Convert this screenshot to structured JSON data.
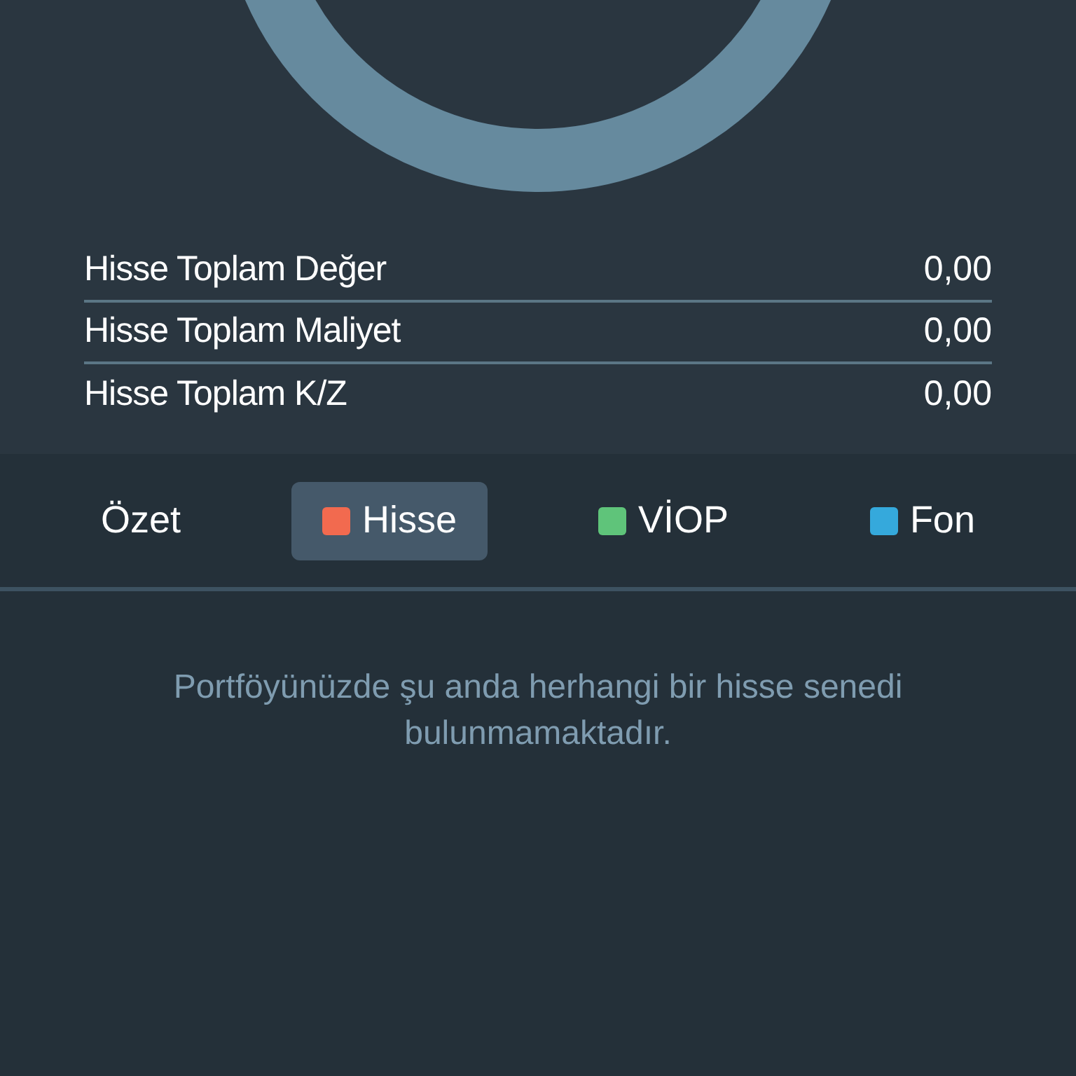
{
  "summary_rows": [
    {
      "label": "Hisse Toplam Değer",
      "value": "0,00"
    },
    {
      "label": "Hisse Toplam Maliyet",
      "value": "0,00"
    },
    {
      "label": "Hisse Toplam K/Z",
      "value": "0,00"
    }
  ],
  "tabs": [
    {
      "label": "Özet",
      "selected": false
    },
    {
      "label": "Hisse",
      "selected": true,
      "color": "#f26a4f"
    },
    {
      "label": "VİOP",
      "selected": false,
      "color": "#5fc47a"
    },
    {
      "label": "Fon",
      "selected": false,
      "color": "#35a9dc"
    }
  ],
  "empty_message": "Portföyünüzde şu anda herhangi bir hisse senedi bulunmamaktadır."
}
